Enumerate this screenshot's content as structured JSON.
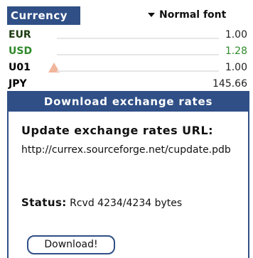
{
  "app": {
    "title": "Currency",
    "font_selector": "Normal font",
    "rates": [
      {
        "code": "EUR",
        "value": "1.00"
      },
      {
        "code": "USD",
        "value": "1.28"
      },
      {
        "code": "U01",
        "value": "1.00"
      },
      {
        "code": "JPY",
        "value": "145.66"
      }
    ]
  },
  "dialog": {
    "title": "Download exchange rates",
    "url_heading": "Update exchange rates URL:",
    "url": "http://currex.sourceforge.net/cupdate.pdb",
    "status_label": "Status:",
    "status_value": "Rcvd 4234/4234 bytes",
    "download_button": "Download!"
  },
  "colors": {
    "title_bar": "#2f4f86",
    "usd_green": "#2f8a2b",
    "warning": "#f1b59b"
  }
}
